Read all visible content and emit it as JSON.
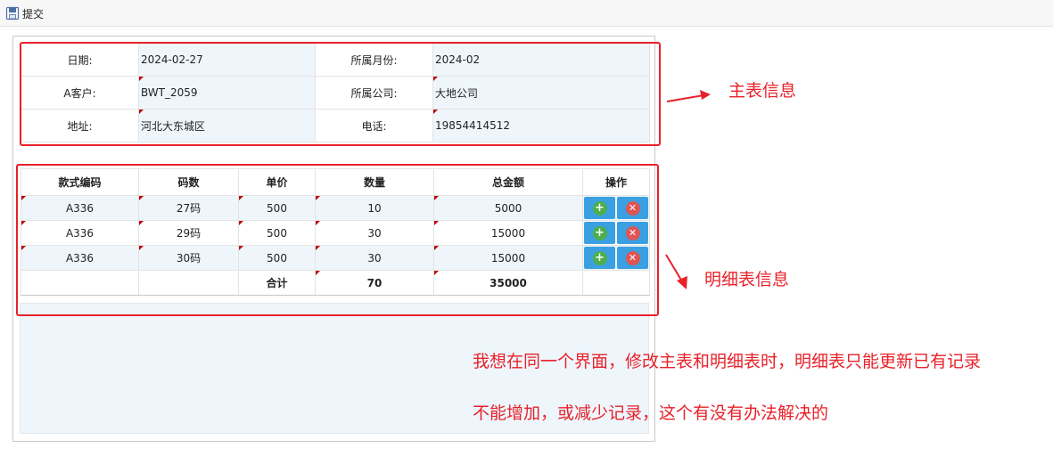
{
  "toolbar": {
    "submit_label": "提交"
  },
  "master": {
    "date_label": "日期:",
    "date_value": "2024-02-27",
    "month_label": "所属月份:",
    "month_value": "2024-02",
    "customer_label": "A客户:",
    "customer_value": "BWT_2059",
    "company_label": "所属公司:",
    "company_value": "大地公司",
    "address_label": "地址:",
    "address_value": "河北大东城区",
    "phone_label": "电话:",
    "phone_value": "19854414512"
  },
  "detail": {
    "headers": [
      "款式编码",
      "码数",
      "单价",
      "数量",
      "总金额",
      "操作"
    ],
    "rows": [
      {
        "style": "A336",
        "size": "27码",
        "price": "500",
        "qty": "10",
        "amount": "5000"
      },
      {
        "style": "A336",
        "size": "29码",
        "price": "500",
        "qty": "30",
        "amount": "15000"
      },
      {
        "style": "A336",
        "size": "30码",
        "price": "500",
        "qty": "30",
        "amount": "15000"
      }
    ],
    "total_label": "合计",
    "total_qty": "70",
    "total_amount": "35000",
    "add_symbol": "+",
    "del_symbol": "✕"
  },
  "annotations": {
    "master_info": "主表信息",
    "detail_info": "明细表信息",
    "question_line1": "我想在同一个界面，修改主表和明细表时，明细表只能更新已有记录",
    "question_line2": "不能增加，或减少记录，这个有没有办法解决的"
  },
  "colors": {
    "annotation_red": "#e8212a",
    "button_blue": "#3aa0e2",
    "add_green": "#4cae4c",
    "delete_red": "#e05454",
    "value_bg": "#eef6fc"
  },
  "icons": {
    "submit": "save-icon",
    "add": "plus-icon",
    "delete": "close-icon"
  }
}
